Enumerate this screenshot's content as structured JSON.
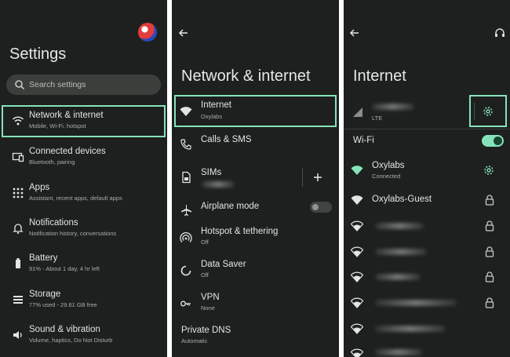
{
  "colors": {
    "background": "#1d201e",
    "accent": "#86e3b9",
    "text": "#e3e5e2",
    "subtext": "#a9aeaa"
  },
  "settings": {
    "title": "Settings",
    "search_placeholder": "Search settings",
    "items": [
      {
        "label": "Network & internet",
        "sub": "Mobile, Wi-Fi, hotspot",
        "icon": "wifi-icon"
      },
      {
        "label": "Connected devices",
        "sub": "Bluetooth, pairing",
        "icon": "connected-devices-icon"
      },
      {
        "label": "Apps",
        "sub": "Assistant, recent apps, default apps",
        "icon": "apps-grid-icon"
      },
      {
        "label": "Notifications",
        "sub": "Notification history, conversations",
        "icon": "bell-icon"
      },
      {
        "label": "Battery",
        "sub": "91% - About 1 day, 4 hr left",
        "icon": "battery-icon"
      },
      {
        "label": "Storage",
        "sub": "77% used - 29.61 GB free",
        "icon": "storage-icon"
      },
      {
        "label": "Sound & vibration",
        "sub": "Volume, haptics, Do Not Disturb",
        "icon": "speaker-icon"
      }
    ]
  },
  "network": {
    "title": "Network & internet",
    "items": [
      {
        "label": "Internet",
        "sub": "Oxylabs",
        "icon": "wifi-icon"
      },
      {
        "label": "Calls & SMS",
        "sub": "",
        "icon": "calls-sms-icon"
      },
      {
        "label": "SIMs",
        "sub": "",
        "icon": "sim-icon"
      },
      {
        "label": "Airplane mode",
        "sub": "",
        "icon": "airplane-icon"
      },
      {
        "label": "Hotspot & tethering",
        "sub": "Off",
        "icon": "hotspot-icon"
      },
      {
        "label": "Data Saver",
        "sub": "Off",
        "icon": "data-saver-icon"
      },
      {
        "label": "VPN",
        "sub": "None",
        "icon": "vpn-icon"
      },
      {
        "label": "Private DNS",
        "sub": "Automatic",
        "icon": ""
      }
    ]
  },
  "internet": {
    "title": "Internet",
    "carrier_sub": "LTE",
    "wifi_label": "Wi-Fi",
    "wifi_enabled": true,
    "networks": [
      {
        "name": "Oxylabs",
        "status": "Connected"
      },
      {
        "name": "Oxylabs-Guest",
        "status": ""
      }
    ]
  }
}
